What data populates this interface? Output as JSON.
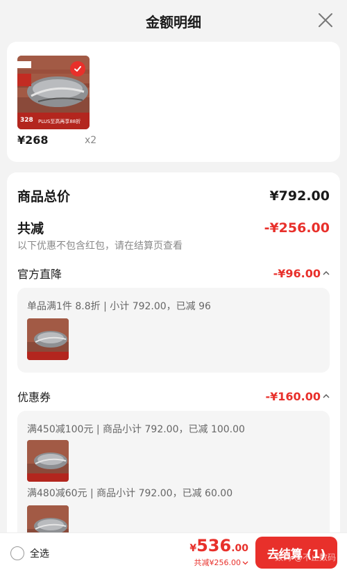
{
  "header": {
    "title": "金额明细"
  },
  "product": {
    "price": "¥268",
    "qty": "x2",
    "image_badge_price": "328",
    "image_badge_text": "PLUS至高再享88折"
  },
  "summary": {
    "total_label": "商品总价",
    "total_value": "¥792.00",
    "discount_label": "共减",
    "discount_value": "-¥256.00",
    "note": "以下优惠不包含红包，请在结算页查看"
  },
  "official": {
    "label": "官方直降",
    "value": "-¥96.00",
    "desc": "单品满1件 8.8折 | 小计 792.00，已减 96"
  },
  "coupon": {
    "label": "优惠券",
    "value": "-¥160.00",
    "items": [
      {
        "desc": "满450减100元 | 商品小计 792.00，已减 100.00"
      },
      {
        "desc": "满480减60元 | 商品小计 792.00，已减 60.00"
      }
    ]
  },
  "footer": {
    "select_all": "全选",
    "currency": "¥",
    "total_int": "536",
    "total_dec": ".00",
    "saved": "共减¥256.00",
    "checkout": "去结算 (1)",
    "watermark": "数码 @不止数码"
  },
  "colors": {
    "accent": "#e8302b",
    "background": "#f3f3f3"
  }
}
